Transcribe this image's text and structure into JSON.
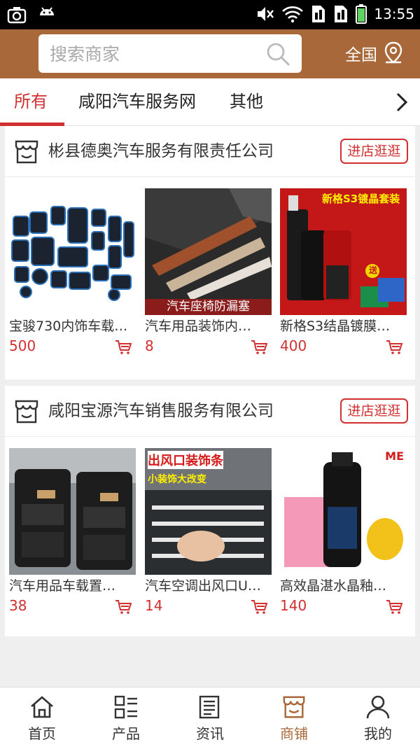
{
  "status_bar": {
    "time": "13:55",
    "icons": [
      "camera-icon",
      "android-icon",
      "mute-icon",
      "wifi-icon",
      "sim1-icon",
      "sim2-icon",
      "battery-icon"
    ]
  },
  "colors": {
    "brand": "#a8683a",
    "accent": "#d23030"
  },
  "header": {
    "search_placeholder": "搜索商家",
    "region_label": "全国"
  },
  "tabs": [
    {
      "label": "所有",
      "active": true
    },
    {
      "label": "咸阳汽车服务网",
      "active": false
    },
    {
      "label": "其他",
      "active": false
    }
  ],
  "shops": [
    {
      "name": "彬县德奥汽车服务有限责任公司",
      "visit_label": "进店逛逛",
      "products": [
        {
          "title": "宝骏730内饰车载…",
          "price": "500"
        },
        {
          "title": "汽车用品装饰内…",
          "price": "8",
          "image_caption": "汽车座椅防漏塞"
        },
        {
          "title": "新格S3结晶镀膜…",
          "price": "400",
          "image_caption": "新格S3镀晶套装",
          "badge": "送"
        }
      ]
    },
    {
      "name": "咸阳宝源汽车销售服务有限公司",
      "visit_label": "进店逛逛",
      "products": [
        {
          "title": "汽车用品车载置…",
          "price": "38"
        },
        {
          "title": "汽车空调出风口U…",
          "price": "14",
          "image_caption": "出风口装饰条",
          "image_subcaption": "小装饰大改变"
        },
        {
          "title": "高效晶湛水晶釉…",
          "price": "140",
          "image_caption": "ME"
        }
      ]
    }
  ],
  "bottom_nav": [
    {
      "label": "首页",
      "icon": "home-icon",
      "active": false
    },
    {
      "label": "产品",
      "icon": "grid-list-icon",
      "active": false
    },
    {
      "label": "资讯",
      "icon": "news-icon",
      "active": false
    },
    {
      "label": "商铺",
      "icon": "shop-icon",
      "active": true
    },
    {
      "label": "我的",
      "icon": "user-icon",
      "active": false
    }
  ]
}
